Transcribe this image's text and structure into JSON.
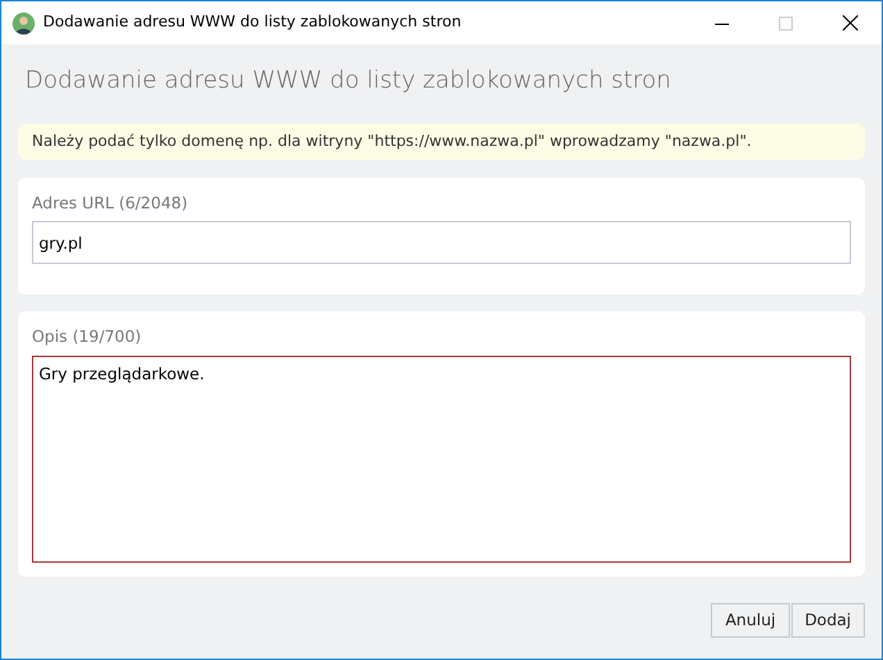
{
  "window": {
    "title": "Dodawanie adresu WWW do listy zablokowanych stron"
  },
  "heading": "Dodawanie adresu WWW do listy zablokowanych stron",
  "notice": "Należy podać tylko domenę np. dla witryny \"https://www.nazwa.pl\" wprowadzamy \"nazwa.pl\".",
  "fields": [
    {
      "kind": "input",
      "label": "Adres URL  (6/2048)",
      "value": "gry.pl",
      "focused": false
    },
    {
      "kind": "textarea",
      "label": "Opis  (19/700)",
      "value": "Gry przeglądarkowe.",
      "focused": true
    }
  ],
  "buttons": [
    "Anuluj",
    "Dodaj"
  ]
}
